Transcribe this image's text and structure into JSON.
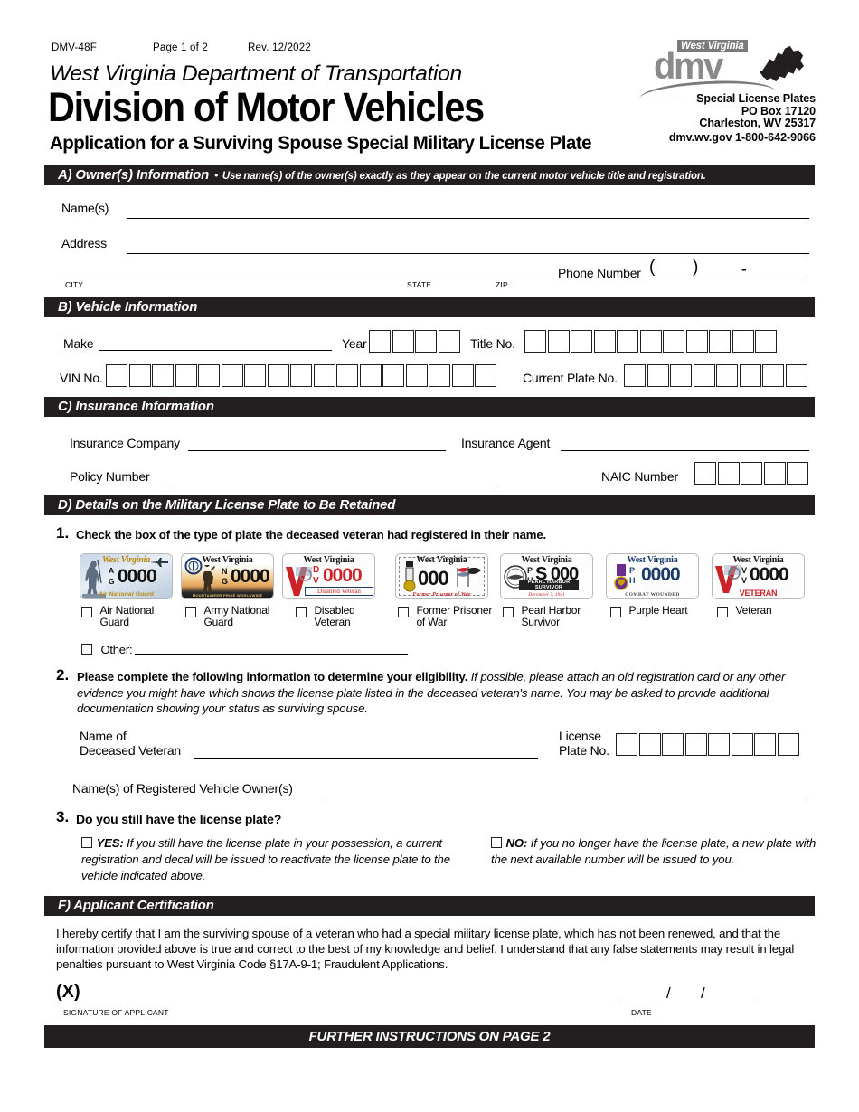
{
  "header": {
    "form_no": "DMV-48F",
    "page_no": "Page 1 of 2",
    "revision": "Rev. 12/2022",
    "dept": "West Virginia Department of Transportation",
    "division": "Division of Motor Vehicles",
    "application_title": "Application for a Surviving Spouse Special Military License Plate"
  },
  "logo": {
    "state_text": "West Virginia",
    "dmv_text": "dmv",
    "office": "Special License Plates",
    "po_box": "PO Box 17120",
    "city_state_zip": "Charleston, WV  25317",
    "website": "dmv.wv.gov",
    "phone": "1-800-642-9066"
  },
  "section_a": {
    "bar_label": "A) Owner(s) Information",
    "bar_bullet": "•",
    "bar_sub": "Use name(s) of the owner(s) exactly as they appear on the current motor vehicle title and registration.",
    "name_label": "Name(s)",
    "address_label": "Address",
    "city_label": "CITY",
    "state_label": "STATE",
    "zip_label": "ZIP",
    "phone_label": "Phone Number",
    "phone_open_paren": "(",
    "phone_close_paren": ")",
    "phone_dash": "-"
  },
  "section_b": {
    "bar_label": "B) Vehicle Information",
    "make_label": "Make",
    "year_label": "Year",
    "year_boxes": 4,
    "title_label": "Title No.",
    "title_boxes": 11,
    "vin_label": "VIN No.",
    "vin_boxes": 17,
    "plate_label": "Current Plate No.",
    "plate_boxes": 8
  },
  "section_c": {
    "bar_label": "C) Insurance Information",
    "company_label": "Insurance Company",
    "agent_label": "Insurance Agent",
    "policy_label": "Policy Number",
    "naic_label": "NAIC Number",
    "naic_boxes": 5
  },
  "section_d": {
    "bar_label": "D) Details on the Military License Plate to Be Retained",
    "item1_number": "1.",
    "item1_text": "Check the box of the type of plate the deceased veteran had registered in their name.",
    "plates": [
      {
        "name": "air-national-guard",
        "label": "Air National Guard",
        "state": "West Virginia",
        "prefix_top": "A",
        "prefix_bottom": "G",
        "number": "0000",
        "bottom_text": "Air National Guard"
      },
      {
        "name": "army-national-guard",
        "label": "Army National Guard",
        "state": "West Virginia",
        "prefix_top": "N",
        "prefix_bottom": "G",
        "number": "0000",
        "bottom_text": "MOUNTAINEER PRIDE WORLDWIDE"
      },
      {
        "name": "disabled-veteran",
        "label": "Disabled Veteran",
        "state": "West Virginia",
        "prefix_top": "D",
        "prefix_bottom": "V",
        "number": "0000",
        "bottom_text": "Disabled Veteran"
      },
      {
        "name": "former-prisoner-of-war",
        "label": "Former Prisoner of War",
        "state": "West Virginia",
        "prefix_top": "",
        "prefix_bottom": "",
        "number": "000",
        "bottom_text": "Former Prisoner of War"
      },
      {
        "name": "pearl-harbor-survivor",
        "label": "Pearl Harbor Survivor",
        "state": "West Virginia",
        "prefix_top": "P",
        "prefix_bottom": "H",
        "number": "S 000",
        "bottom_text": "PEARL HARBOR SURVIVOR",
        "bottom_text2": "December 7, 1941"
      },
      {
        "name": "purple-heart",
        "label": "Purple Heart",
        "state": "West Virginia",
        "prefix_top": "P",
        "prefix_bottom": "H",
        "number": "0000",
        "bottom_text": "COMBAT WOUNDED"
      },
      {
        "name": "veteran",
        "label": "Veteran",
        "state": "West Virginia",
        "prefix_top": "V",
        "prefix_bottom": "V",
        "number": "0000",
        "bottom_text": "VETERAN"
      }
    ],
    "other_label": "Other:",
    "item2_number": "2.",
    "item2_bold": "Please complete the following information to determine your eligibility.",
    "item2_italic": "If possible, please attach an old registration card or any other evidence you might have which shows the license plate listed in the deceased veteran's name. You may be asked to provide additional documentation showing your status as surviving spouse.",
    "deceased_label_line1": "Name of",
    "deceased_label_line2": "Deceased Veteran",
    "license_label_line1": "License",
    "license_label_line2": "Plate No.",
    "license_boxes": 8,
    "registered_owners_label": "Name(s) of Registered Vehicle Owner(s)",
    "item3_number": "3.",
    "item3_text": "Do you still have the license plate?",
    "yes_bold": "YES:",
    "yes_text": "If you still have the license plate in your possession, a current registration and decal will be issued to reactivate the license plate to the vehicle indicated above.",
    "no_bold": "NO:",
    "no_text": "If you no longer have the license plate, a new plate with the next available number will be issued to you."
  },
  "section_f": {
    "bar_label": "F) Applicant Certification",
    "certification_text": "I hereby certify that I am the surviving spouse of a veteran who had a special military license plate, which has not been renewed, and that the information provided above is true and correct to the best of my knowledge and belief.  I understand that any false statements may result in legal penalties pursuant to West Virginia Code §17A-9-1; Fraudulent Applications.",
    "signature_x": "(X)",
    "signature_label": "SIGNATURE OF APPLICANT",
    "date_label": "DATE",
    "date_slash1": "/",
    "date_slash2": "/"
  },
  "footer": {
    "text": "FURTHER INSTRUCTIONS ON PAGE 2"
  },
  "colors": {
    "bar_bg": "#231f20",
    "logo_gray": "#8a8a8a",
    "plate_blue": "#1b3a6b",
    "plate_red": "#cc2127",
    "purple": "#6b2d8f"
  }
}
